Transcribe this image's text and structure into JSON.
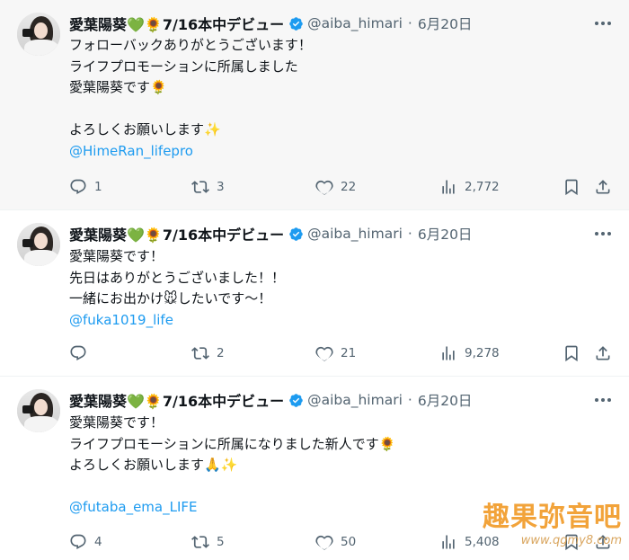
{
  "colors": {
    "text": "#0f1419",
    "secondary": "#536471",
    "link": "#1d9bf0",
    "verified": "#1d9bf0",
    "highlight_bg": "#f7f7f7",
    "watermark": "#f2a33a"
  },
  "tweets": [
    {
      "display_name": "愛葉陽葵💚🌻7/16本中デビュー",
      "handle": "@aiba_himari",
      "separator": "·",
      "date": "6月20日",
      "lines": [
        "フォローバックありがとうございます！",
        "ライフプロモーションに所属しました",
        "愛葉陽葵です🌻",
        "",
        "よろしくお願いします✨"
      ],
      "mention": "@HimeRan_lifepro",
      "stats": {
        "replies": "1",
        "retweets": "3",
        "likes": "22",
        "views": "2,772"
      }
    },
    {
      "display_name": "愛葉陽葵💚🌻7/16本中デビュー",
      "handle": "@aiba_himari",
      "separator": "·",
      "date": "6月20日",
      "lines": [
        "愛葉陽葵です！",
        "先日はありがとうございました！！",
        "一緒にお出かけ🐭したいです〜！"
      ],
      "mention": "@fuka1019_life",
      "stats": {
        "replies": "",
        "retweets": "2",
        "likes": "21",
        "views": "9,278"
      }
    },
    {
      "display_name": "愛葉陽葵💚🌻7/16本中デビュー",
      "handle": "@aiba_himari",
      "separator": "·",
      "date": "6月20日",
      "lines": [
        "愛葉陽葵です！",
        "ライフプロモーションに所属になりました新人です🌻",
        "よろしくお願いします🙏✨",
        ""
      ],
      "mention": "@futaba_ema_LIFE",
      "stats": {
        "replies": "4",
        "retweets": "5",
        "likes": "50",
        "views": "5,408"
      }
    }
  ],
  "icons": {
    "reply": "reply-icon",
    "retweet": "retweet-icon",
    "like": "heart-icon",
    "views": "views-icon",
    "bookmark": "bookmark-icon",
    "share": "share-icon",
    "more": "more-icon",
    "verified": "verified-badge-icon"
  },
  "watermark": {
    "title": "趣果弥音吧",
    "url": "www.qgmy8.com"
  }
}
